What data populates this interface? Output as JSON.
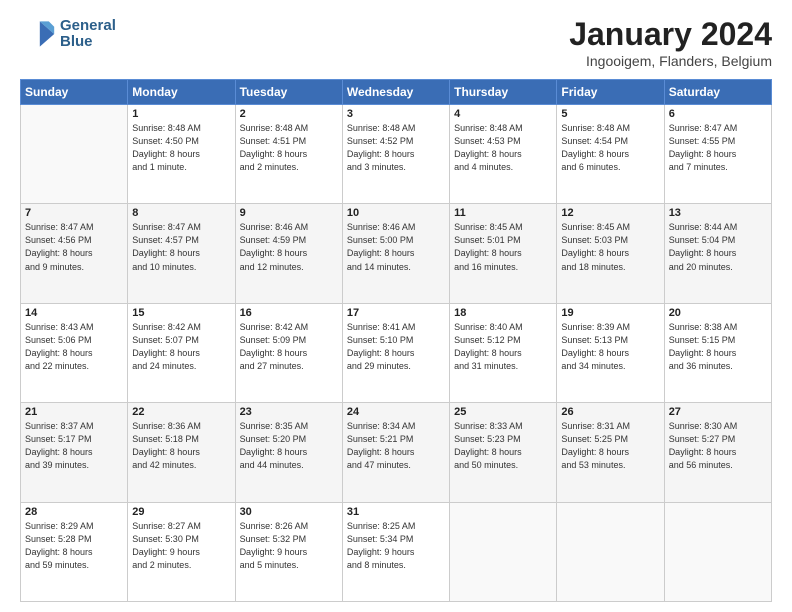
{
  "logo": {
    "line1": "General",
    "line2": "Blue"
  },
  "title": "January 2024",
  "subtitle": "Ingooigem, Flanders, Belgium",
  "days_header": [
    "Sunday",
    "Monday",
    "Tuesday",
    "Wednesday",
    "Thursday",
    "Friday",
    "Saturday"
  ],
  "weeks": [
    [
      {
        "day": "",
        "info": ""
      },
      {
        "day": "1",
        "info": "Sunrise: 8:48 AM\nSunset: 4:50 PM\nDaylight: 8 hours\nand 1 minute."
      },
      {
        "day": "2",
        "info": "Sunrise: 8:48 AM\nSunset: 4:51 PM\nDaylight: 8 hours\nand 2 minutes."
      },
      {
        "day": "3",
        "info": "Sunrise: 8:48 AM\nSunset: 4:52 PM\nDaylight: 8 hours\nand 3 minutes."
      },
      {
        "day": "4",
        "info": "Sunrise: 8:48 AM\nSunset: 4:53 PM\nDaylight: 8 hours\nand 4 minutes."
      },
      {
        "day": "5",
        "info": "Sunrise: 8:48 AM\nSunset: 4:54 PM\nDaylight: 8 hours\nand 6 minutes."
      },
      {
        "day": "6",
        "info": "Sunrise: 8:47 AM\nSunset: 4:55 PM\nDaylight: 8 hours\nand 7 minutes."
      }
    ],
    [
      {
        "day": "7",
        "info": "Sunrise: 8:47 AM\nSunset: 4:56 PM\nDaylight: 8 hours\nand 9 minutes."
      },
      {
        "day": "8",
        "info": "Sunrise: 8:47 AM\nSunset: 4:57 PM\nDaylight: 8 hours\nand 10 minutes."
      },
      {
        "day": "9",
        "info": "Sunrise: 8:46 AM\nSunset: 4:59 PM\nDaylight: 8 hours\nand 12 minutes."
      },
      {
        "day": "10",
        "info": "Sunrise: 8:46 AM\nSunset: 5:00 PM\nDaylight: 8 hours\nand 14 minutes."
      },
      {
        "day": "11",
        "info": "Sunrise: 8:45 AM\nSunset: 5:01 PM\nDaylight: 8 hours\nand 16 minutes."
      },
      {
        "day": "12",
        "info": "Sunrise: 8:45 AM\nSunset: 5:03 PM\nDaylight: 8 hours\nand 18 minutes."
      },
      {
        "day": "13",
        "info": "Sunrise: 8:44 AM\nSunset: 5:04 PM\nDaylight: 8 hours\nand 20 minutes."
      }
    ],
    [
      {
        "day": "14",
        "info": "Sunrise: 8:43 AM\nSunset: 5:06 PM\nDaylight: 8 hours\nand 22 minutes."
      },
      {
        "day": "15",
        "info": "Sunrise: 8:42 AM\nSunset: 5:07 PM\nDaylight: 8 hours\nand 24 minutes."
      },
      {
        "day": "16",
        "info": "Sunrise: 8:42 AM\nSunset: 5:09 PM\nDaylight: 8 hours\nand 27 minutes."
      },
      {
        "day": "17",
        "info": "Sunrise: 8:41 AM\nSunset: 5:10 PM\nDaylight: 8 hours\nand 29 minutes."
      },
      {
        "day": "18",
        "info": "Sunrise: 8:40 AM\nSunset: 5:12 PM\nDaylight: 8 hours\nand 31 minutes."
      },
      {
        "day": "19",
        "info": "Sunrise: 8:39 AM\nSunset: 5:13 PM\nDaylight: 8 hours\nand 34 minutes."
      },
      {
        "day": "20",
        "info": "Sunrise: 8:38 AM\nSunset: 5:15 PM\nDaylight: 8 hours\nand 36 minutes."
      }
    ],
    [
      {
        "day": "21",
        "info": "Sunrise: 8:37 AM\nSunset: 5:17 PM\nDaylight: 8 hours\nand 39 minutes."
      },
      {
        "day": "22",
        "info": "Sunrise: 8:36 AM\nSunset: 5:18 PM\nDaylight: 8 hours\nand 42 minutes."
      },
      {
        "day": "23",
        "info": "Sunrise: 8:35 AM\nSunset: 5:20 PM\nDaylight: 8 hours\nand 44 minutes."
      },
      {
        "day": "24",
        "info": "Sunrise: 8:34 AM\nSunset: 5:21 PM\nDaylight: 8 hours\nand 47 minutes."
      },
      {
        "day": "25",
        "info": "Sunrise: 8:33 AM\nSunset: 5:23 PM\nDaylight: 8 hours\nand 50 minutes."
      },
      {
        "day": "26",
        "info": "Sunrise: 8:31 AM\nSunset: 5:25 PM\nDaylight: 8 hours\nand 53 minutes."
      },
      {
        "day": "27",
        "info": "Sunrise: 8:30 AM\nSunset: 5:27 PM\nDaylight: 8 hours\nand 56 minutes."
      }
    ],
    [
      {
        "day": "28",
        "info": "Sunrise: 8:29 AM\nSunset: 5:28 PM\nDaylight: 8 hours\nand 59 minutes."
      },
      {
        "day": "29",
        "info": "Sunrise: 8:27 AM\nSunset: 5:30 PM\nDaylight: 9 hours\nand 2 minutes."
      },
      {
        "day": "30",
        "info": "Sunrise: 8:26 AM\nSunset: 5:32 PM\nDaylight: 9 hours\nand 5 minutes."
      },
      {
        "day": "31",
        "info": "Sunrise: 8:25 AM\nSunset: 5:34 PM\nDaylight: 9 hours\nand 8 minutes."
      },
      {
        "day": "",
        "info": ""
      },
      {
        "day": "",
        "info": ""
      },
      {
        "day": "",
        "info": ""
      }
    ]
  ]
}
